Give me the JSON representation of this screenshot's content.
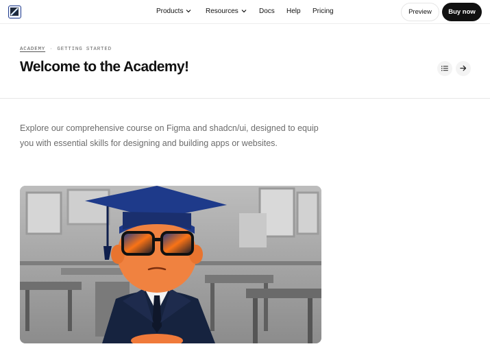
{
  "nav": {
    "items": [
      {
        "label": "Products",
        "has_dropdown": true
      },
      {
        "label": "Resources",
        "has_dropdown": true
      },
      {
        "label": "Docs",
        "has_dropdown": false
      },
      {
        "label": "Help",
        "has_dropdown": false
      },
      {
        "label": "Pricing",
        "has_dropdown": false
      }
    ],
    "preview_label": "Preview",
    "buy_label": "Buy now"
  },
  "breadcrumb": {
    "section": "ACADEMY",
    "separator": "·",
    "current": "GETTING STARTED"
  },
  "page": {
    "title": "Welcome to the Academy!",
    "intro": "Explore our comprehensive course on Figma and shadcn/ui, designed to equip you with essential skills for designing and building apps or websites."
  },
  "icons": {
    "logo": "logo-icon",
    "dropdown": "chevron-down-icon",
    "toc": "list-icon",
    "next": "arrow-right-icon"
  },
  "colors": {
    "buy_button": "#111111",
    "logo_border": "#1e3a8a",
    "intro_text": "#6b6b6b"
  }
}
